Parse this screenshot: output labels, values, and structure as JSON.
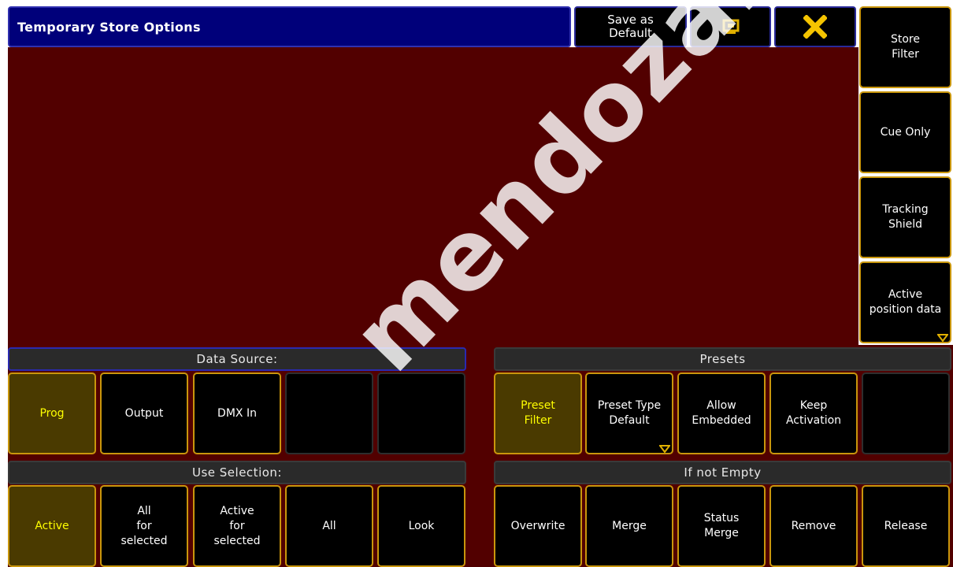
{
  "window": {
    "title": "Temporary Store Options",
    "save_default_label": "Save as\nDefault",
    "monitor_icon": "monitor-icon",
    "close_icon": "close-icon"
  },
  "side_menu": [
    {
      "label": "Store\nFilter"
    },
    {
      "label": "Cue Only"
    },
    {
      "label": "Tracking\nShield"
    },
    {
      "label": "Active\nposition data"
    }
  ],
  "data_source": {
    "header": "Data Source:",
    "buttons": [
      "Prog",
      "Output",
      "DMX In",
      "",
      ""
    ],
    "selected": "Prog"
  },
  "presets": {
    "header": "Presets",
    "buttons": [
      "Preset\nFilter",
      "Preset Type\nDefault",
      "Allow\nEmbedded",
      "Keep\nActivation",
      ""
    ],
    "selected": "Preset Filter"
  },
  "use_selection": {
    "header": "Use Selection:",
    "buttons": [
      "Active",
      "All\nfor\nselected",
      "Active\nfor\nselected",
      "All",
      "Look"
    ],
    "selected": "Active"
  },
  "if_not_empty": {
    "header": "If not Empty",
    "buttons": [
      "Overwrite",
      "Merge",
      "Status\nMerge",
      "Remove",
      "Release"
    ]
  },
  "watermark": "mendoza.com.",
  "colors": {
    "background": "#520000",
    "title_bar": "#00007a",
    "button_border": "#c9960c",
    "selected_fill": "#4a3a00",
    "selected_text": "#ffff00",
    "close_icon": "#f5c400",
    "monitor_icon": "#e0b000"
  }
}
